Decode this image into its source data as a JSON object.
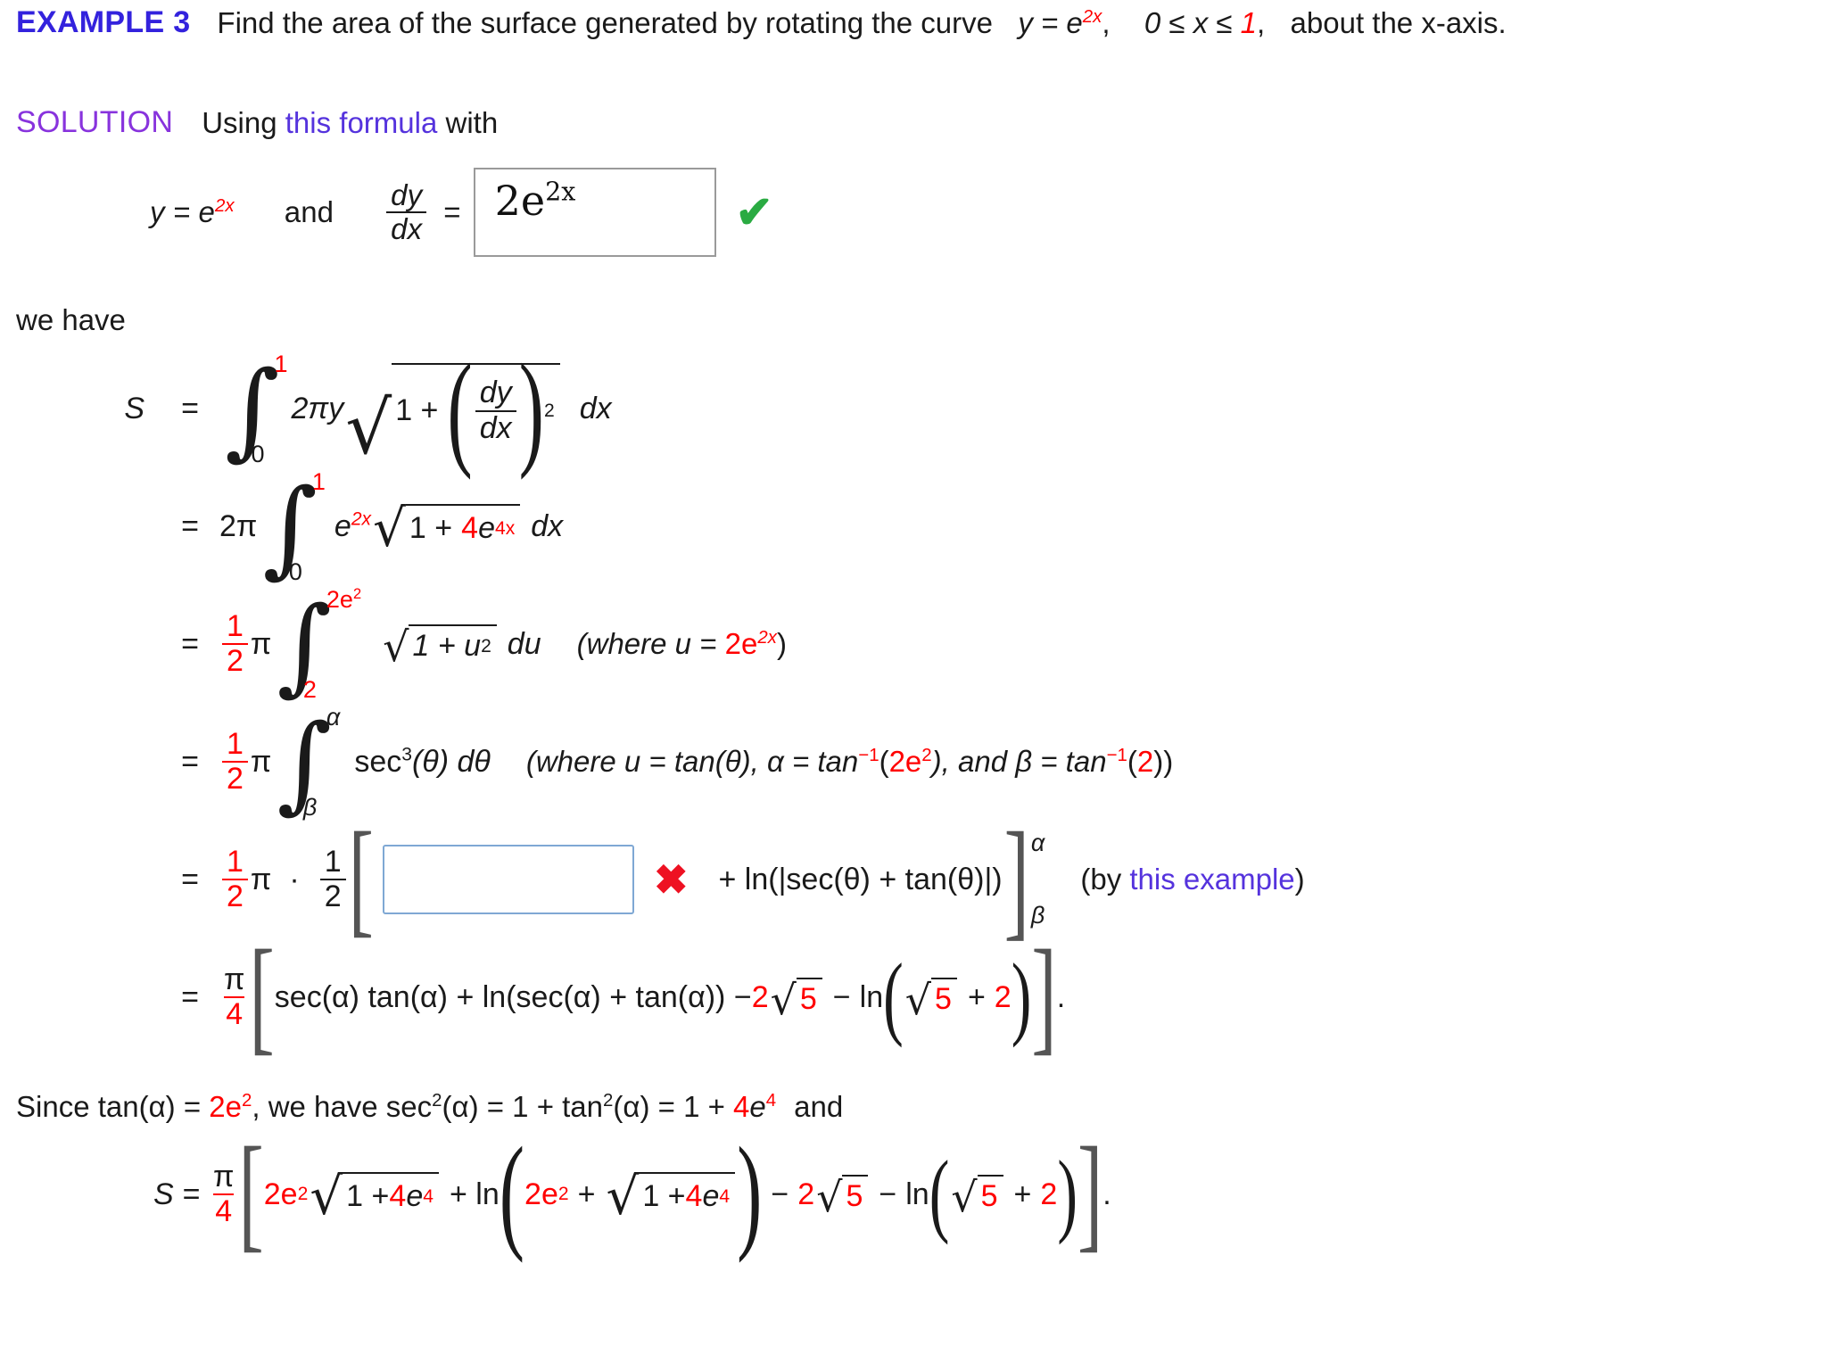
{
  "colors": {
    "heading": "#3322dd",
    "solution_label": "#8833dd",
    "link": "#5533dd",
    "red": "#ff0000",
    "correct": "#2aab42",
    "incorrect": "#ee1122",
    "box_border_grey": "#9a9a9a",
    "box_border_blue": "#7fa8d4"
  },
  "header": {
    "example_label": "EXAMPLE 3",
    "statement_a": "Find the area of the surface generated by rotating the curve",
    "statement_y": "y = e",
    "statement_exp": "2x",
    "statement_comma": ",",
    "statement_range_a": "0 ≤ x ≤",
    "statement_range_num": "1",
    "statement_range_b": ",",
    "statement_b": "about the x-axis."
  },
  "solution": {
    "label": "SOLUTION",
    "using": "Using",
    "link_text": "this formula",
    "with": "with",
    "we_have": "we have"
  },
  "derivative_line": {
    "y_eq": "y = e",
    "y_exp": "2x",
    "and": "and",
    "frac_num": "dy",
    "frac_den": "dx",
    "equals": "=",
    "answer_value": "2e",
    "answer_exp": "2x",
    "mark": "✔",
    "mark_state": "correct"
  },
  "equations": [
    {
      "lhs": "S",
      "eq": "=",
      "int_upper": "1",
      "int_lower": "0",
      "integrand_pre": "2πy",
      "rad_body": "1 +",
      "frac_num": "dy",
      "frac_den": "dx",
      "paren_exp": "2",
      "differential": "dx",
      "note": ""
    },
    {
      "lhs": "",
      "eq": "=",
      "coef": "2π",
      "int_upper": "1",
      "int_lower": "0",
      "integrand_pre": "e",
      "integrand_pre_exp": "2x",
      "rad_one": "1 +",
      "rad_four": "4",
      "rad_e": "e",
      "rad_e_exp": "4x",
      "differential": "dx",
      "note": ""
    },
    {
      "lhs": "",
      "eq": "=",
      "frac_num": "1",
      "frac_den": "2",
      "pi": "π",
      "int_upper": "2e",
      "int_upper_exp": "2",
      "int_lower": "2",
      "rad_body": "1 + u",
      "rad_exp": "2",
      "differential": "du",
      "note_pre": "(where u = ",
      "note_red": "2e",
      "note_red_exp": "2x",
      "note_post": ")"
    },
    {
      "lhs": "",
      "eq": "=",
      "frac_num": "1",
      "frac_den": "2",
      "pi": "π",
      "int_upper": "α",
      "int_lower": "β",
      "integrand": "sec",
      "integrand_exp": "3",
      "integrand_post": "(θ) dθ",
      "note_1": "(where u = tan(θ), α = tan",
      "note_exp_1": "−1",
      "note_2": "(",
      "note_red_1": "2e",
      "note_red_1_exp": "2",
      "note_3": "), and β = tan",
      "note_exp_2": "−1",
      "note_4": "(",
      "note_red_2": "2",
      "note_5": "))"
    },
    {
      "lhs": "",
      "eq": "=",
      "frac1_num": "1",
      "frac1_den": "2",
      "pi": "π",
      "dot": "·",
      "frac2_num": "1",
      "frac2_den": "2",
      "open_bracket": "[",
      "input_value": "",
      "mark": "✖",
      "mark_state": "incorrect",
      "tail": "+ ln(|sec(θ) + tan(θ)|)",
      "close_bracket": "]",
      "eval_upper": "α",
      "eval_lower": "β",
      "note_pre": "(by ",
      "note_link": "this example",
      "note_post": ")"
    },
    {
      "lhs": "",
      "eq": "=",
      "frac_num": "π",
      "frac_den": "4",
      "open_bracket": "[",
      "body_1": "sec(α) tan(α) + ln(sec(α) + tan(α)) − ",
      "red_2": "2",
      "rad1_body": "5",
      "minus": "−",
      "ln": "ln",
      "rad2_body": "5",
      "plus": "+",
      "red_2b": "2",
      "close_bracket": "]",
      "period": "."
    }
  ],
  "since_line": {
    "since": "Since  tan(α) = ",
    "red_2e": "2e",
    "red_2e_exp": "2",
    "mid": ",  we have  sec",
    "sec_exp": "2",
    "mid2": "(α) = 1 + tan",
    "tan_exp": "2",
    "mid3": "(α) = 1 + ",
    "red_4": "4",
    "e": "e",
    "e_exp": "4",
    "tail": "and"
  },
  "final_line": {
    "lhs": "S =",
    "frac_num": "π",
    "frac_den": "4",
    "open_bracket": "[",
    "red_2e": "2e",
    "red_2e_exp": "2",
    "rad1_one": "1 + ",
    "rad1_red4": "4",
    "rad1_e": "e",
    "rad1_e_exp": "4",
    "plus_ln": "+ ln",
    "paren_open": "(",
    "red_2e_b": "2e",
    "red_2e_b_exp": "2",
    "plus": "+",
    "rad2_one": "1 + ",
    "rad2_red4": "4",
    "rad2_e": "e",
    "rad2_e_exp": "4",
    "paren_close": ")",
    "minus1": "−",
    "red_2c": "2",
    "rad3_body": "5",
    "minus2": "−",
    "ln2": "ln",
    "paren2_open": "(",
    "rad4_body": "5",
    "plus2": "+",
    "red_2d": "2",
    "paren2_close": ")",
    "close_bracket": "]",
    "period": "."
  }
}
